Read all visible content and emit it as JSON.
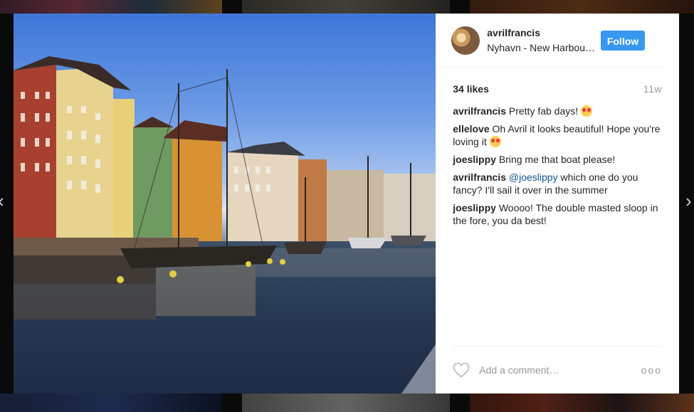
{
  "post": {
    "username": "avrilfrancis",
    "location": "Nyhavn - New Harbou…",
    "follow_label": "Follow",
    "likes": "34 likes",
    "time": "11w",
    "caption": {
      "user": "avrilfrancis",
      "text": "Pretty fab days! ",
      "emoji": "heart-eyes-emoji"
    }
  },
  "comments": [
    {
      "user": "ellelove",
      "text": "Oh Avril it looks beautiful! Hope you're loving it ",
      "emoji": "kiss-emoji"
    },
    {
      "user": "joeslippy",
      "text": "Bring me that boat please!"
    },
    {
      "user": "avrilfrancis",
      "mention": "@joeslippy",
      "text": " which one do you fancy? I'll sail it over in the summer"
    },
    {
      "user": "joeslippy",
      "text": "Woooo! The double masted sloop in the fore, you da best!"
    }
  ],
  "footer": {
    "comment_placeholder": "Add a comment…",
    "more_label": "ooo",
    "like_icon": "heart-outline-icon"
  },
  "nav": {
    "prev_icon": "chevron-left-icon",
    "next_icon": "chevron-right-icon"
  },
  "colors": {
    "accent": "#3897f0",
    "mention": "#125688",
    "muted": "#999999",
    "text": "#262626"
  }
}
